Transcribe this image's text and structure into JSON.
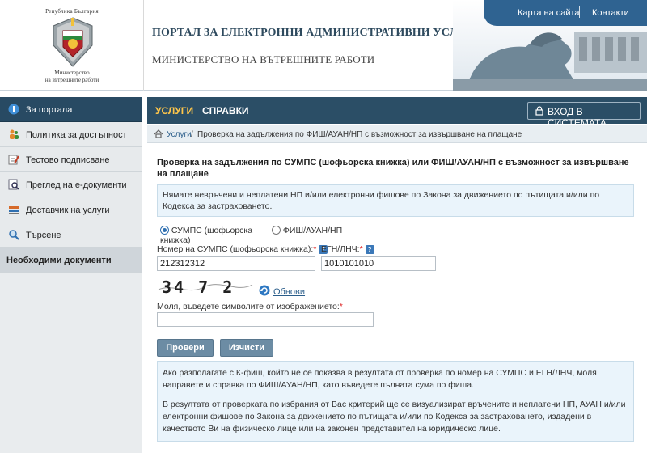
{
  "header": {
    "crest_top": "Република България",
    "crest_bottom_1": "Министерство",
    "crest_bottom_2": "на вътрешните работи",
    "portal_title": "ПОРТАЛ ЗА ЕЛЕКТРОННИ АДМИНИСТРАТИВНИ УСЛУГИ",
    "ministry_title": "МИНИСТЕРСТВО НА ВЪТРЕШНИТЕ РАБОТИ",
    "links": [
      "Карта на сайта",
      "Контакти"
    ],
    "accent_color": "#2f6391"
  },
  "sidebar": {
    "items": [
      {
        "label": "За портала",
        "icon": "info-icon"
      },
      {
        "label": "Политика за достъпност",
        "icon": "people-icon"
      },
      {
        "label": "Тестово подписване",
        "icon": "signature-icon"
      },
      {
        "label": "Преглед на е-документи",
        "icon": "document-search-icon"
      },
      {
        "label": "Доставчик на услуги",
        "icon": "stack-icon"
      },
      {
        "label": "Търсене",
        "icon": "search-icon"
      },
      {
        "label": "Необходими документи",
        "icon": ""
      }
    ]
  },
  "nav": {
    "tabs": [
      "УСЛУГИ",
      "СПРАВКИ"
    ],
    "active_tab_color": "#ffc64a",
    "login_label": "ВХОД В СИСТЕМАТА"
  },
  "breadcrumb": {
    "items": [
      "Услуги",
      "Проверка на задължения по ФИШ/АУАН/НП с възможност за извършване на плащане"
    ],
    "separator": "/"
  },
  "main": {
    "title": "Проверка на задължения по СУМПС (шофьорска книжка) или ФИШ/АУАН/НП с възможност за извършване на плащане",
    "notice": "Нямате невръчени и неплатени НП и/или електронни фишове по Закона за движението по пътищата и/или по Кодекса за застраховането.",
    "radio_options": [
      "СУМПС (шофьорска книжка)",
      "ФИШ/АУАН/НП"
    ],
    "radio_selected": "СУМПС (шофьорска книжка)",
    "license_label": "Номер на СУМПС (шофьорска книжка):",
    "license_value": "212312312",
    "egn_label": "ЕГН/ЛНЧ:",
    "egn_value": "1010101010",
    "required_mark": "*",
    "help_mark": "?",
    "captcha_text": "34 7 2",
    "refresh_label": "Обнови",
    "captcha_prompt": "Моля, въведете символите от изображението:",
    "captcha_value": "",
    "check_button": "Провери",
    "clear_button": "Изчисти",
    "info_1": "Ако разполагате с К-фиш, който не се показва в резултата от проверка по номер на СУМПС и ЕГН/ЛНЧ, моля направете и справка по ФИШ/АУАН/НП, като въведете пълната сума по фиша.",
    "info_2": "В резултата от проверката по избрания от Вас критерий ще се визуализират връчените и неплатени НП, АУАН и/или електронни фишове по Закона за движението по пътищата и/или по Кодекса за застраховането, издадени в качеството Ви на физическо лице или на законен представител на юридическо лице."
  }
}
